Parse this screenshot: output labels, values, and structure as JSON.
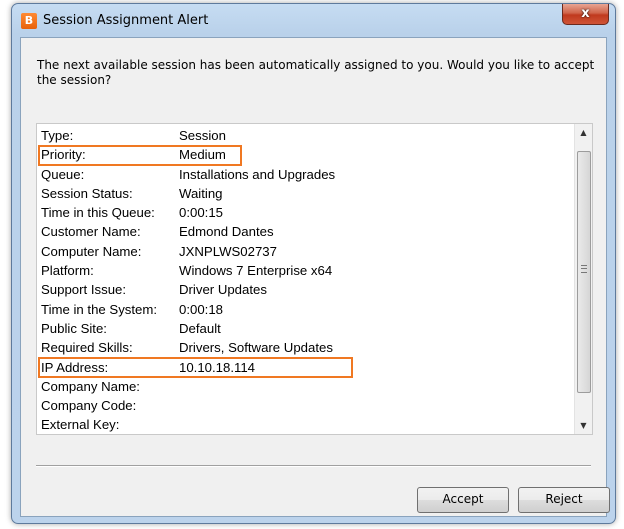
{
  "window": {
    "icon_letter": "B",
    "title": "Session Assignment Alert",
    "close_label": "x",
    "accent_color": "#f07822"
  },
  "message": "The next available session has been automatically assigned to you.  Would you like to accept the session?",
  "details": [
    {
      "label": "Type:",
      "value": "Session"
    },
    {
      "label": "Priority:",
      "value": "Medium"
    },
    {
      "label": "Queue:",
      "value": "Installations and Upgrades"
    },
    {
      "label": "Session Status:",
      "value": "Waiting"
    },
    {
      "label": "Time in this Queue:",
      "value": "0:00:15"
    },
    {
      "label": "Customer Name:",
      "value": "Edmond Dantes"
    },
    {
      "label": "Computer Name:",
      "value": "JXNPLWS02737"
    },
    {
      "label": "Platform:",
      "value": "Windows 7 Enterprise x64"
    },
    {
      "label": "Support Issue:",
      "value": "Driver Updates"
    },
    {
      "label": "Time in the System:",
      "value": "0:00:18"
    },
    {
      "label": "Public Site:",
      "value": "Default"
    },
    {
      "label": "Required Skills:",
      "value": "Drivers, Software Updates"
    },
    {
      "label": "IP Address:",
      "value": "10.10.18.114"
    },
    {
      "label": "Company Name:",
      "value": ""
    },
    {
      "label": "Company Code:",
      "value": ""
    },
    {
      "label": "External Key:",
      "value": ""
    }
  ],
  "buttons": {
    "accept": "Accept",
    "reject": "Reject"
  }
}
